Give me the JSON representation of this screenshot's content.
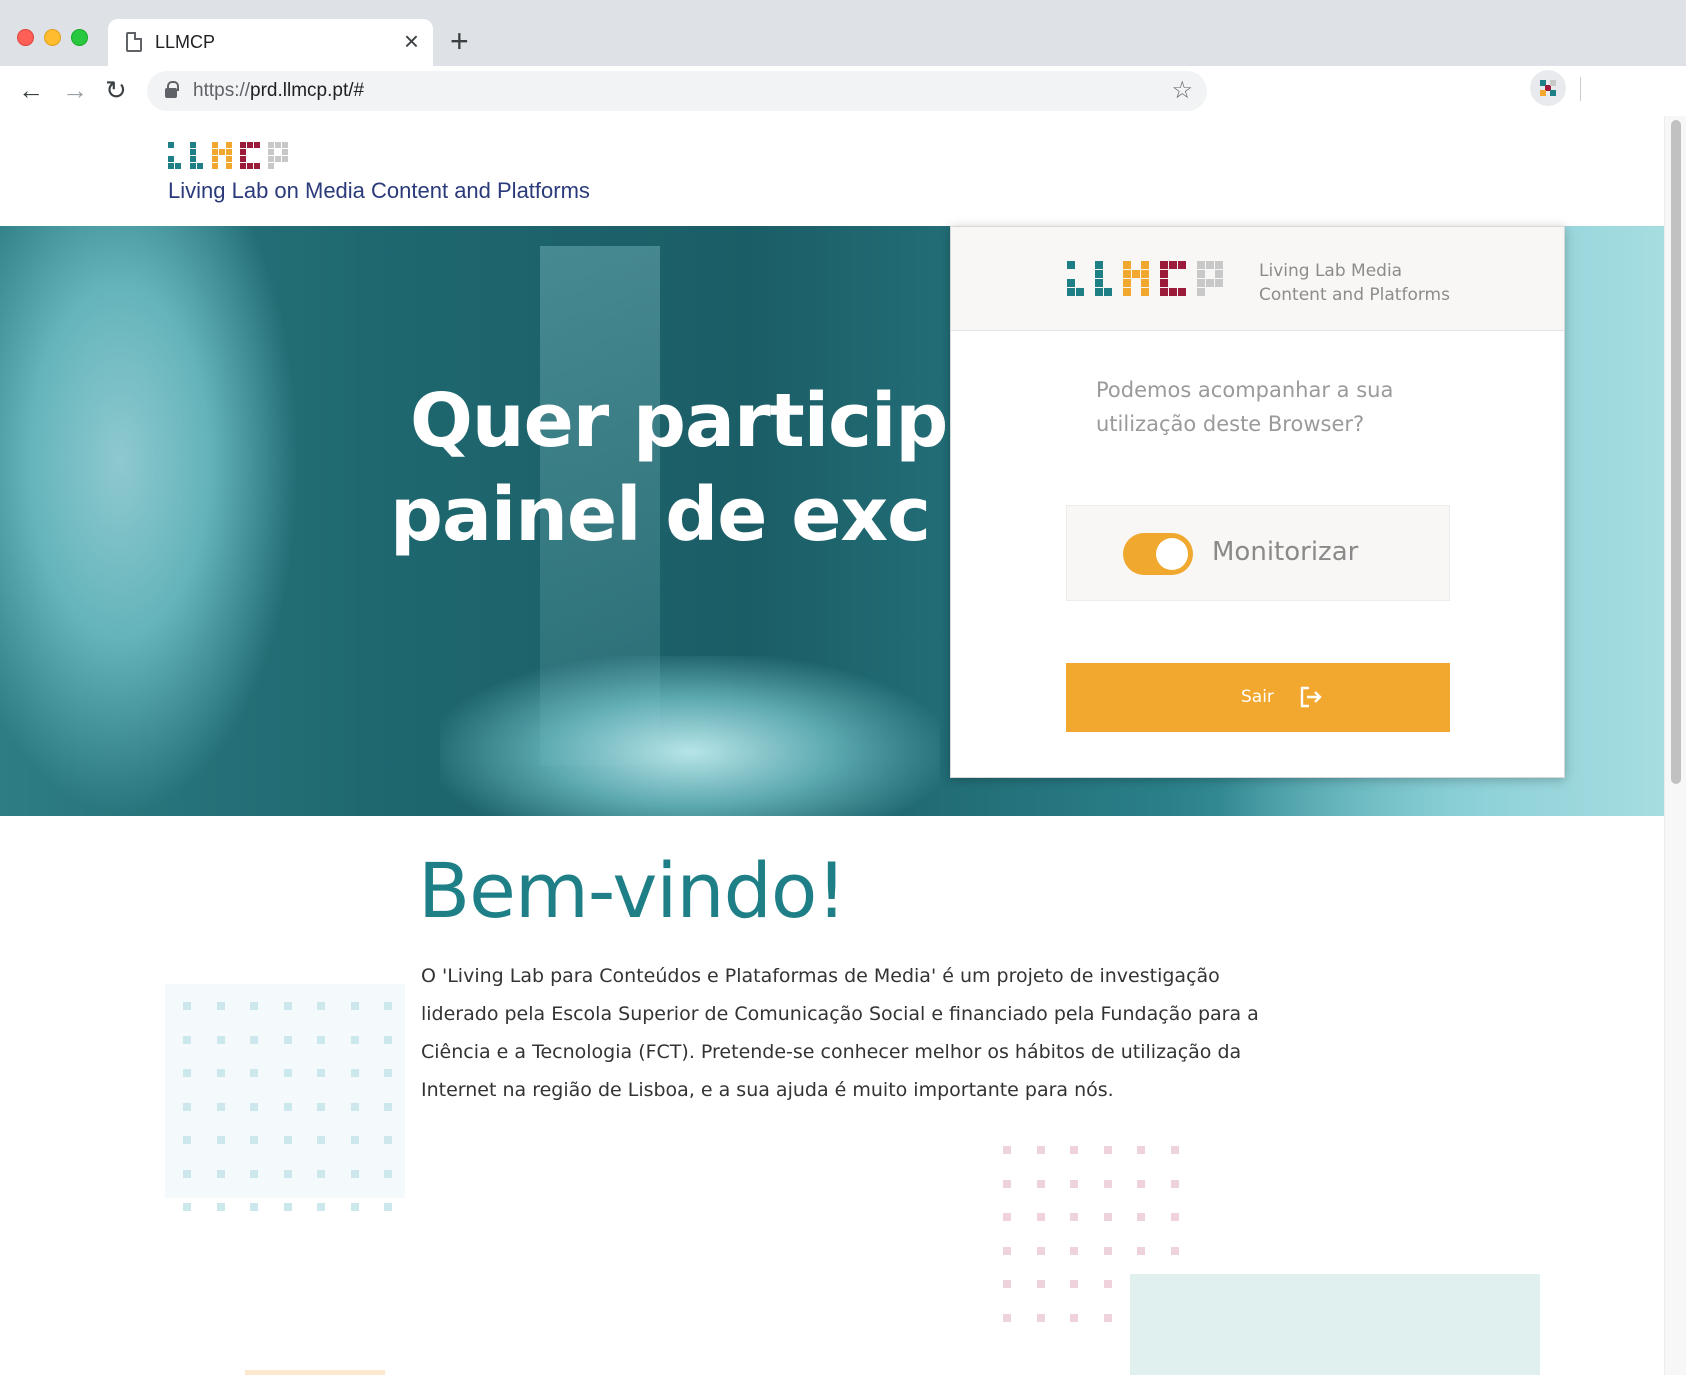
{
  "browser": {
    "tab_title": "LLMCP",
    "tab_close_glyph": "×",
    "new_tab_glyph": "+",
    "url_scheme": "https://",
    "url_host": "prd.llmcp.pt/#",
    "icons": {
      "back": "back-arrow-icon",
      "forward": "forward-arrow-icon",
      "reload": "reload-icon",
      "lock": "lock-icon",
      "bookmark": "star-icon",
      "extension": "llmcp-extension-icon"
    }
  },
  "site": {
    "tagline": "Living Lab on Media Content and Platforms",
    "hero_line1": "Quer particip",
    "hero_line2": "painel de exc",
    "welcome_title": "Bem-vindo!",
    "welcome_text": "O 'Living Lab para Conteúdos e Plataformas de Media' é um projeto de investigação liderado pela Escola Superior de Comunicação Social e financiado pela Fundação para a Ciência e a Tecnologia (FCT). Pretende-se conhecer melhor os hábitos de utilização da Internet na região de Lisboa, e a sua ajuda é muito importante para nós."
  },
  "popup": {
    "brand_line1": "Living Lab Media",
    "brand_line2": "Content and Platforms",
    "question": "Podemos acompanhar a sua utilização deste Browser?",
    "toggle_label": "Monitorizar",
    "toggle_on": true,
    "exit_label": "Sair",
    "exit_icon": "logout-icon"
  },
  "colors": {
    "brand_teal": "#1f7f87",
    "brand_orange": "#f2a72e",
    "brand_crimson": "#9b1c3a",
    "brand_blue_text": "#2a3a7a",
    "logo_gray": "#c8c8c8"
  }
}
